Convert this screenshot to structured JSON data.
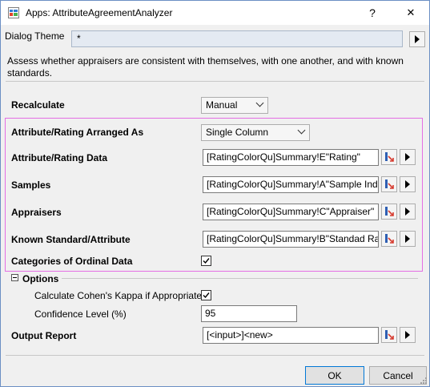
{
  "window": {
    "title": "Apps: AttributeAgreementAnalyzer",
    "help_label": "?",
    "close_label": "✕"
  },
  "theme": {
    "label": "Dialog Theme",
    "value": "*"
  },
  "description": "Assess whether appraisers are consistent with themselves, with one another, and with known standards.",
  "recalculate": {
    "label": "Recalculate",
    "value": "Manual"
  },
  "fields": {
    "arranged_as": {
      "label": "Attribute/Rating Arranged As",
      "value": "Single Column"
    },
    "rating_data": {
      "label": "Attribute/Rating Data",
      "value": "[RatingColorQu]Summary!E\"Rating\""
    },
    "samples": {
      "label": "Samples",
      "value": "[RatingColorQu]Summary!A\"Sample Index\""
    },
    "appraisers": {
      "label": "Appraisers",
      "value": "[RatingColorQu]Summary!C\"Appraiser\""
    },
    "known_standard": {
      "label": "Known Standard/Attribute",
      "value": "[RatingColorQu]Summary!B\"Standad Rating\""
    },
    "ordinal": {
      "label": "Categories of Ordinal Data",
      "checked": true
    }
  },
  "options": {
    "label": "Options",
    "kappa": {
      "label": "Calculate Cohen's Kappa if Appropriate",
      "checked": true
    },
    "confidence": {
      "label": "Confidence Level (%)",
      "value": "95"
    }
  },
  "output": {
    "label": "Output Report",
    "value": "[<input>]<new>"
  },
  "buttons": {
    "ok": "OK",
    "cancel": "Cancel"
  },
  "colors": {
    "highlight_border": "#e46ee4",
    "default_button_border": "#0078d7"
  }
}
